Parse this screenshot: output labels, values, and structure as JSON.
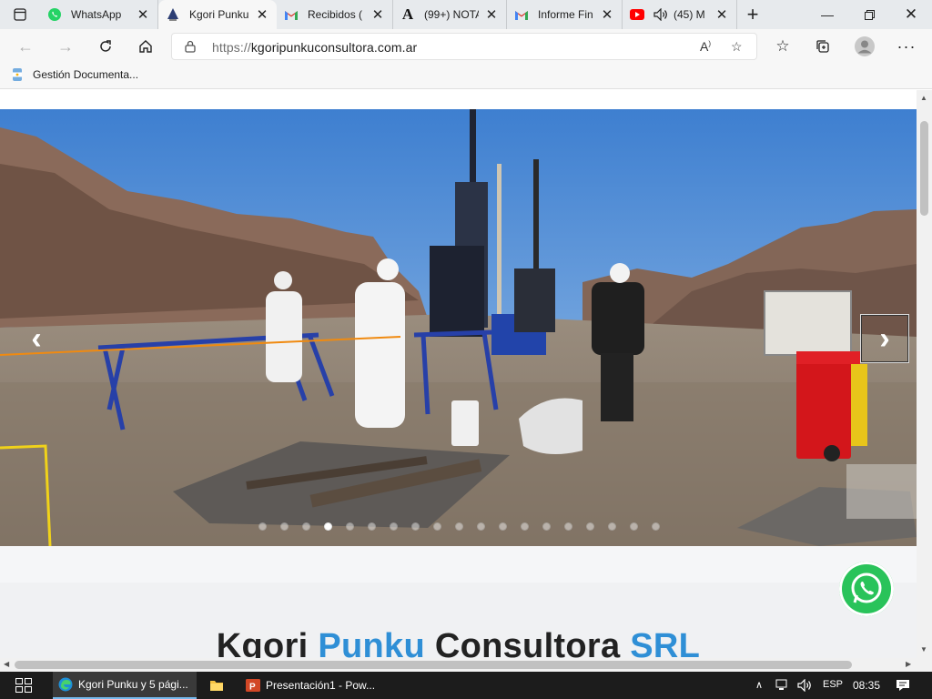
{
  "browser": {
    "tabs": [
      {
        "title": "WhatsApp",
        "icon": "whatsapp-icon"
      },
      {
        "title": "Kgori Punku",
        "icon": "kgori-logo-icon",
        "active": true
      },
      {
        "title": "Recibidos (",
        "icon": "gmail-icon"
      },
      {
        "title": "(99+) NOTA",
        "icon": "a-letter-icon"
      },
      {
        "title": "Informe Fin",
        "icon": "gmail-icon"
      },
      {
        "title": "(45) M",
        "icon": "youtube-icon"
      }
    ],
    "url_scheme": "https://",
    "url_host": "kgoripunkuconsultora.com.ar",
    "bookmark": "Gestión Documenta..."
  },
  "page": {
    "carousel_active_index": 3,
    "carousel_count": 19,
    "title_part1": "Kgori ",
    "title_part2": "Punku",
    "title_part3": " Consultora ",
    "title_part4": "SRL"
  },
  "taskbar": {
    "edge_label": "Kgori Punku y 5 pági...",
    "ppt_label": "Presentación1 - Pow...",
    "lang": "ESP",
    "time": "08:35"
  },
  "colors": {
    "accent_blue": "#2f8fd6",
    "whatsapp_green": "#29c35a"
  }
}
